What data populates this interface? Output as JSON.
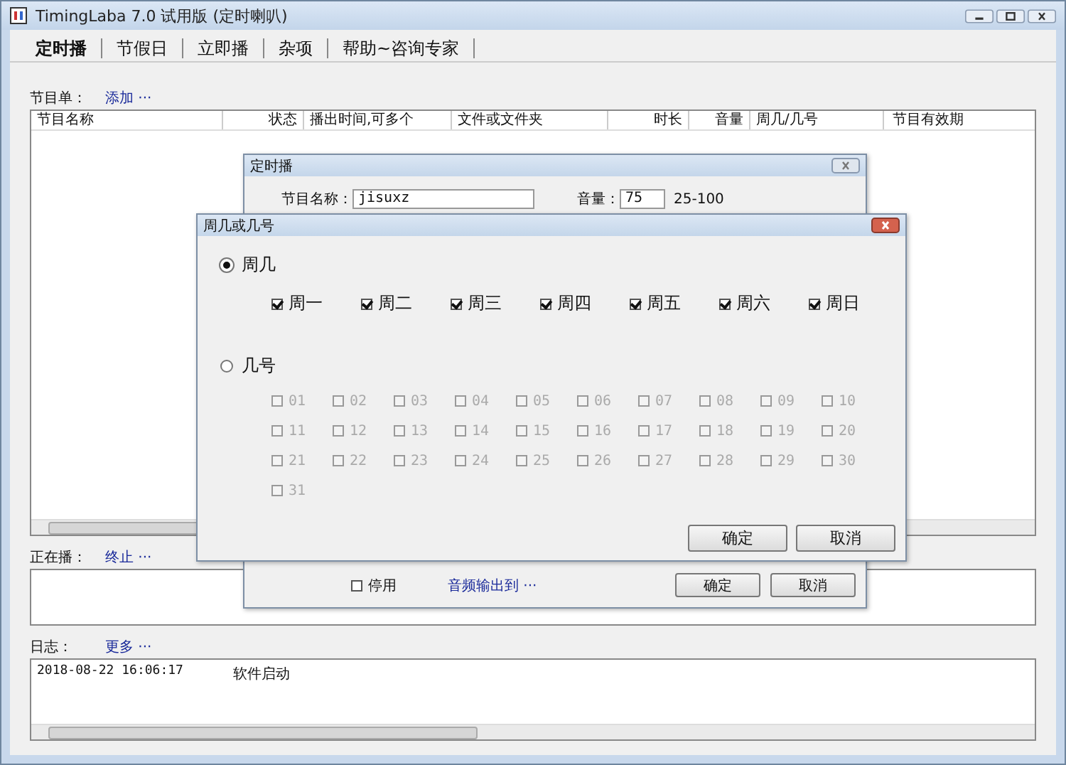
{
  "window": {
    "title": "TimingLaba 7.0 试用版 (定时喇叭)"
  },
  "tabs": [
    {
      "label": "定时播",
      "selected": true
    },
    {
      "label": "节假日",
      "selected": false
    },
    {
      "label": "立即播",
      "selected": false
    },
    {
      "label": "杂项",
      "selected": false
    },
    {
      "label": "帮助~咨询专家",
      "selected": false
    }
  ],
  "program_list": {
    "label": "节目单：",
    "link": "添加 ···",
    "columns": [
      "节目名称",
      "状态",
      "播出时间,可多个",
      "文件或文件夹",
      "时长",
      "音量",
      "周几/几号",
      "节目有效期"
    ]
  },
  "now_playing": {
    "label": "正在播：",
    "link": "终止 ···"
  },
  "log": {
    "label": "日志：",
    "link": "更多 ···",
    "entries": [
      {
        "time": "2018-08-22 16:06:17",
        "message": "软件启动"
      }
    ]
  },
  "schedule_dialog": {
    "title": "定时播",
    "name_label": "节目名称：",
    "name_value": "jisuxz",
    "volume_label": "音量：",
    "volume_value": "75",
    "volume_range": "25-100",
    "disable": {
      "label": "停用",
      "checked": false
    },
    "output_link": "音频输出到 ···",
    "buttons": [
      "确定",
      "取消"
    ]
  },
  "weekday_dialog": {
    "title": "周几或几号",
    "modes": [
      {
        "label": "周几",
        "selected": true
      },
      {
        "label": "几号",
        "selected": false
      }
    ],
    "weekdays": [
      {
        "label": "周一",
        "checked": true
      },
      {
        "label": "周二",
        "checked": true
      },
      {
        "label": "周三",
        "checked": true
      },
      {
        "label": "周四",
        "checked": true
      },
      {
        "label": "周五",
        "checked": true
      },
      {
        "label": "周六",
        "checked": true
      },
      {
        "label": "周日",
        "checked": true
      }
    ],
    "days": [
      {
        "label": "01",
        "checked": false
      },
      {
        "label": "02",
        "checked": false
      },
      {
        "label": "03",
        "checked": false
      },
      {
        "label": "04",
        "checked": false
      },
      {
        "label": "05",
        "checked": false
      },
      {
        "label": "06",
        "checked": false
      },
      {
        "label": "07",
        "checked": false
      },
      {
        "label": "08",
        "checked": false
      },
      {
        "label": "09",
        "checked": false
      },
      {
        "label": "10",
        "checked": false
      },
      {
        "label": "11",
        "checked": false
      },
      {
        "label": "12",
        "checked": false
      },
      {
        "label": "13",
        "checked": false
      },
      {
        "label": "14",
        "checked": false
      },
      {
        "label": "15",
        "checked": false
      },
      {
        "label": "16",
        "checked": false
      },
      {
        "label": "17",
        "checked": false
      },
      {
        "label": "18",
        "checked": false
      },
      {
        "label": "19",
        "checked": false
      },
      {
        "label": "20",
        "checked": false
      },
      {
        "label": "21",
        "checked": false
      },
      {
        "label": "22",
        "checked": false
      },
      {
        "label": "23",
        "checked": false
      },
      {
        "label": "24",
        "checked": false
      },
      {
        "label": "25",
        "checked": false
      },
      {
        "label": "26",
        "checked": false
      },
      {
        "label": "27",
        "checked": false
      },
      {
        "label": "28",
        "checked": false
      },
      {
        "label": "29",
        "checked": false
      },
      {
        "label": "30",
        "checked": false
      },
      {
        "label": "31",
        "checked": false
      }
    ],
    "buttons": [
      "确定",
      "取消"
    ]
  }
}
